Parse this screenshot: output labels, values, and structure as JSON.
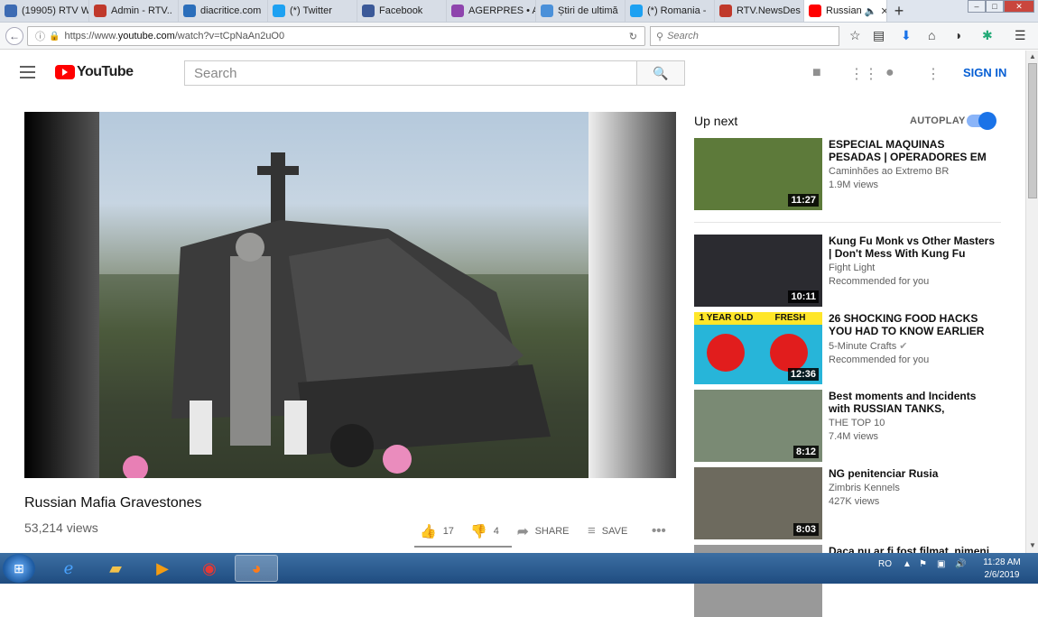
{
  "browser": {
    "tabs": [
      {
        "title": "(19905) RTV W",
        "color": "#3d6bb3",
        "icon": "globe-icon"
      },
      {
        "title": "Admin - RTV..",
        "color": "#c0392b",
        "icon": "r-icon"
      },
      {
        "title": "diacritice.com",
        "color": "#2a6ebb",
        "icon": "d-icon"
      },
      {
        "title": "(*) Twitter",
        "color": "#1da1f2",
        "icon": "twitter-icon"
      },
      {
        "title": "Facebook",
        "color": "#3b5998",
        "icon": "facebook-icon"
      },
      {
        "title": "AGERPRES • A",
        "color": "#8e44ad",
        "icon": "agerpres-icon"
      },
      {
        "title": "Știri de ultimă",
        "color": "#4a90d9",
        "icon": "news-icon"
      },
      {
        "title": "(*) Romania -",
        "color": "#1da1f2",
        "icon": "twitter-icon"
      },
      {
        "title": "RTV.NewsDes",
        "color": "#c0392b",
        "icon": "r-icon"
      }
    ],
    "active_tab": {
      "title": "Russian",
      "color": "#ff0000"
    },
    "url_prefix": "https://www.",
    "url_domain": "youtube.com",
    "url_path": "/watch?v=tCpNaAn2uO0",
    "search_placeholder": "Search"
  },
  "youtube": {
    "logo_text": "YouTube",
    "search_placeholder": "Search",
    "sign_in": "SIGN IN",
    "video": {
      "title": "Russian Mafia Gravestones",
      "views": "53,214 views",
      "likes": "17",
      "dislikes": "4",
      "share": "SHARE",
      "save": "SAVE"
    },
    "up_next": "Up next",
    "autoplay": "AUTOPLAY",
    "recommendations": [
      {
        "title": "ESPECIAL MAQUINAS PESADAS | OPERADORES EM",
        "channel": "Caminhões ao Extremo BR",
        "meta": "1.9M views",
        "duration": "11:27",
        "thumb": "#5d7a3a"
      },
      {
        "title": "Kung Fu Monk vs Other Masters | Don't Mess With Kung Fu",
        "channel": "Fight Light",
        "meta": "Recommended for you",
        "duration": "10:11",
        "thumb": "#2b2b30"
      },
      {
        "title": "26 SHOCKING FOOD HACKS YOU HAD TO KNOW EARLIER",
        "channel": "5-Minute Crafts",
        "meta": "Recommended for you",
        "duration": "12:36",
        "thumb": "#27b5d9",
        "thumb_labels": [
          "1 YEAR OLD",
          "FRESH"
        ]
      },
      {
        "title": "Best moments and Incidents with RUSSIAN TANKS,",
        "channel": "THE TOP 10",
        "meta": "7.4M views",
        "duration": "8:12",
        "thumb": "#7a8a74"
      },
      {
        "title": "NG penitenciar Rusia",
        "channel": "Zimbris Kennels",
        "meta": "427K views",
        "duration": "8:03",
        "thumb": "#6d6a5e"
      },
      {
        "title": "Daca nu ar fi fost filmat, nimeni",
        "channel": "",
        "meta": "",
        "duration": "",
        "thumb": "#999"
      }
    ]
  },
  "taskbar": {
    "language": "RO",
    "time": "11:28 AM",
    "date": "2/6/2019"
  }
}
